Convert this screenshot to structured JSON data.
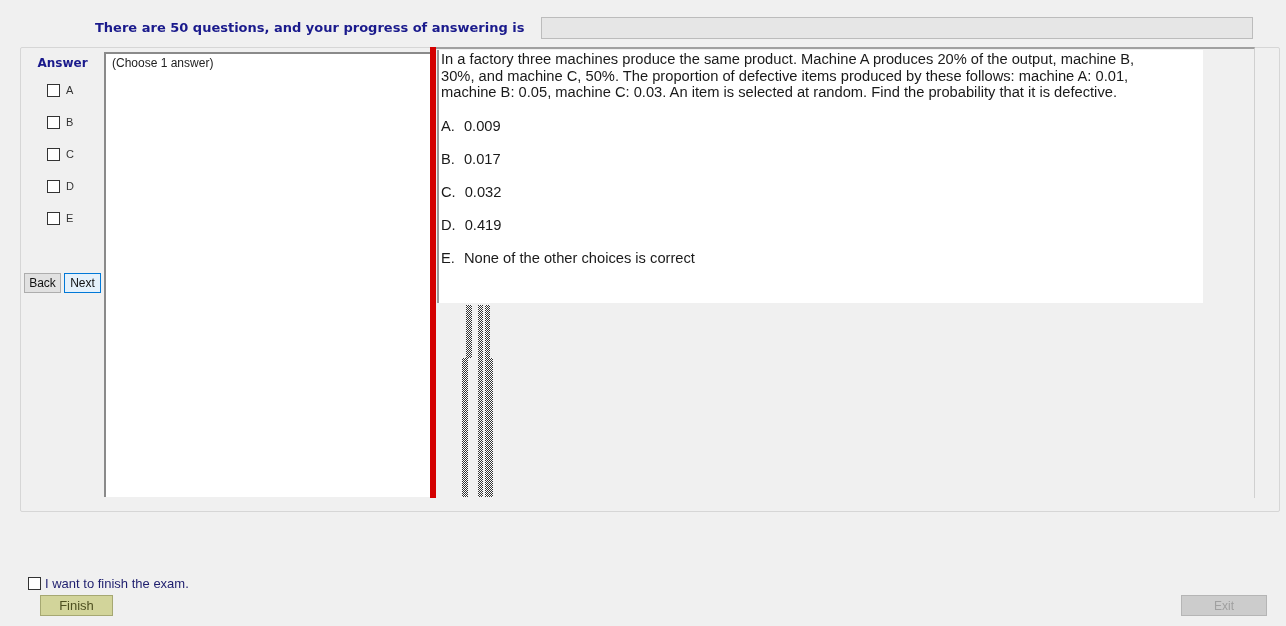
{
  "header": {
    "progress_text": "There are 50 questions, and your progress of answering is",
    "progress": {
      "level": 0
    }
  },
  "answer_panel": {
    "title": "Answer",
    "options": [
      {
        "label": "A",
        "checked": false
      },
      {
        "label": "B",
        "checked": false
      },
      {
        "label": "C",
        "checked": false
      },
      {
        "label": "D",
        "checked": false
      },
      {
        "label": "E",
        "checked": false
      }
    ],
    "buttons": [
      {
        "label": "Back",
        "focused": false
      },
      {
        "label": "Next",
        "focused": true
      }
    ]
  },
  "instruction": "(Choose 1 answer)",
  "question": {
    "text": "In a factory three machines produce the same product. Machine A produces 20% of the output, machine B, 30%, and machine C, 50%. The proportion of defective items produced by these follows: machine A: 0.01, machine B: 0.05, machine C: 0.03. An item is selected at random. Find the probability that it is defective.",
    "choices": [
      {
        "letter": "A.",
        "text": "0.009"
      },
      {
        "letter": "B.",
        "text": "0.017"
      },
      {
        "letter": "C.",
        "text": "0.032"
      },
      {
        "letter": "D.",
        "text": "0.419"
      },
      {
        "letter": "E.",
        "text": "None of the other choices is correct"
      }
    ]
  },
  "footer": {
    "finish_checkbox": {
      "label": "I want to finish the exam.",
      "checked": false
    },
    "finish_button": {
      "label": "Finish"
    },
    "exit_button": {
      "label": "Exit",
      "disabled": true
    }
  }
}
